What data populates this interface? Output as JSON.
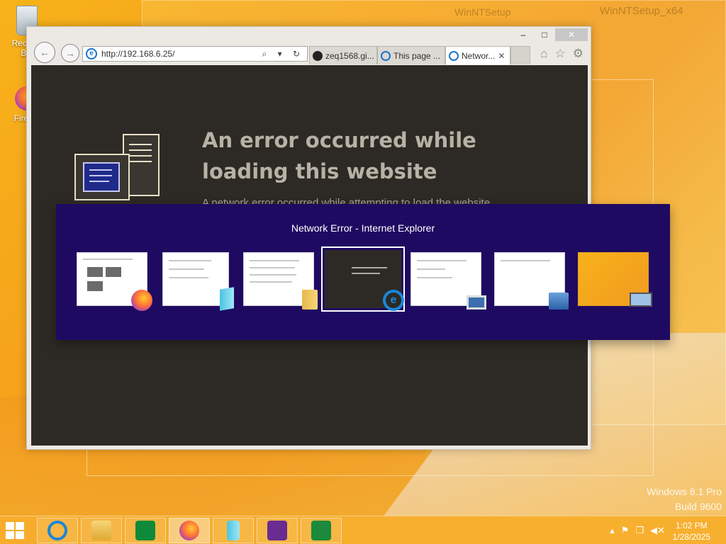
{
  "background_window": {
    "title_left": "WinNTSetup",
    "title_right": "WinNTSetup_x64"
  },
  "desktop": {
    "icons": [
      {
        "label": "Recycle Bin"
      },
      {
        "label": "Firefox"
      }
    ]
  },
  "ie_window": {
    "controls": {
      "minimize": "–",
      "maximize": "□",
      "close": "✕"
    },
    "nav": {
      "back": "←",
      "forward": "→"
    },
    "address": {
      "url": "http://192.168.6.25/",
      "tools": "⌕ ▾ ↻"
    },
    "tabs": [
      {
        "label": "zeq1568.gi...",
        "icon": "github-icon",
        "active": false
      },
      {
        "label": "This page ...",
        "icon": "ie-icon",
        "active": false
      },
      {
        "label": "Networ...",
        "icon": "ie-icon",
        "active": true
      }
    ],
    "toolbar_right": {
      "home": "⌂",
      "favorites": "☆",
      "settings": "⚙"
    },
    "content": {
      "error_title": "An error occurred while loading this website",
      "error_subtitle": "A network error occurred while attempting to load the website."
    }
  },
  "switcher": {
    "title": "Network Error - Internet Explorer",
    "thumbnails": [
      {
        "app": "Firefox",
        "badge": "firefox-icon"
      },
      {
        "app": "Reader",
        "badge": "book-icon"
      },
      {
        "app": "File Explorer",
        "badge": "folder-icon"
      },
      {
        "app": "Internet Explorer",
        "badge": "ie-icon",
        "selected": true
      },
      {
        "app": "This PC",
        "badge": "computer-icon"
      },
      {
        "app": "Setup",
        "badge": "setup-icon"
      },
      {
        "app": "Desktop",
        "badge": "laptop-icon"
      }
    ]
  },
  "taskbar": {
    "apps": [
      "Internet Explorer",
      "File Explorer",
      "Store",
      "Firefox",
      "Reader",
      "Visual Studio",
      "Calculator"
    ],
    "tray": {
      "chevron": "▴",
      "flag": "⚑",
      "network": "❐",
      "volume": "◀✕"
    },
    "time": "1:02 PM",
    "date": "1/28/2025"
  },
  "watermark": {
    "line1": "Windows 8.1 Pro",
    "line2": "Build 9600"
  },
  "colors": {
    "wallpaper": "#f6a21c",
    "switcher_bg": "#1f0a62",
    "ie_content_bg": "#2d2a25",
    "error_title": "#b8b2a6"
  }
}
